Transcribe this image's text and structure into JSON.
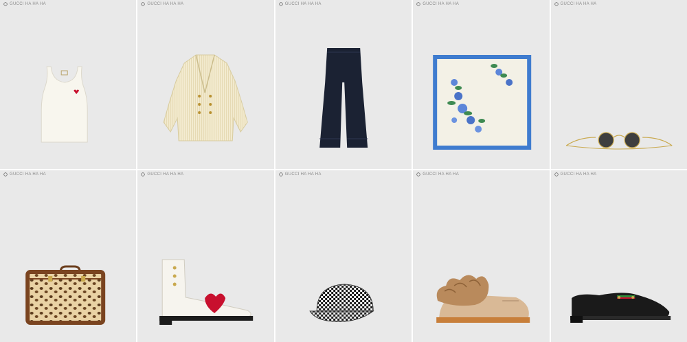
{
  "tag_label": "GUCCI HA HA HA",
  "products": [
    {
      "icon": "tank-top-icon"
    },
    {
      "icon": "blazer-icon"
    },
    {
      "icon": "trousers-icon"
    },
    {
      "icon": "floral-scarf-icon"
    },
    {
      "icon": "sunglasses-icon"
    },
    {
      "icon": "leopard-suitcase-icon"
    },
    {
      "icon": "heart-boot-icon"
    },
    {
      "icon": "houndstooth-cap-icon"
    },
    {
      "icon": "fur-shoe-icon"
    },
    {
      "icon": "loafer-icon"
    }
  ],
  "colors": {
    "card_bg": "#e9e9e9",
    "tag_text": "#8a8a8a",
    "scarf_border": "#3f7ccf",
    "heart_red": "#c8102e"
  }
}
